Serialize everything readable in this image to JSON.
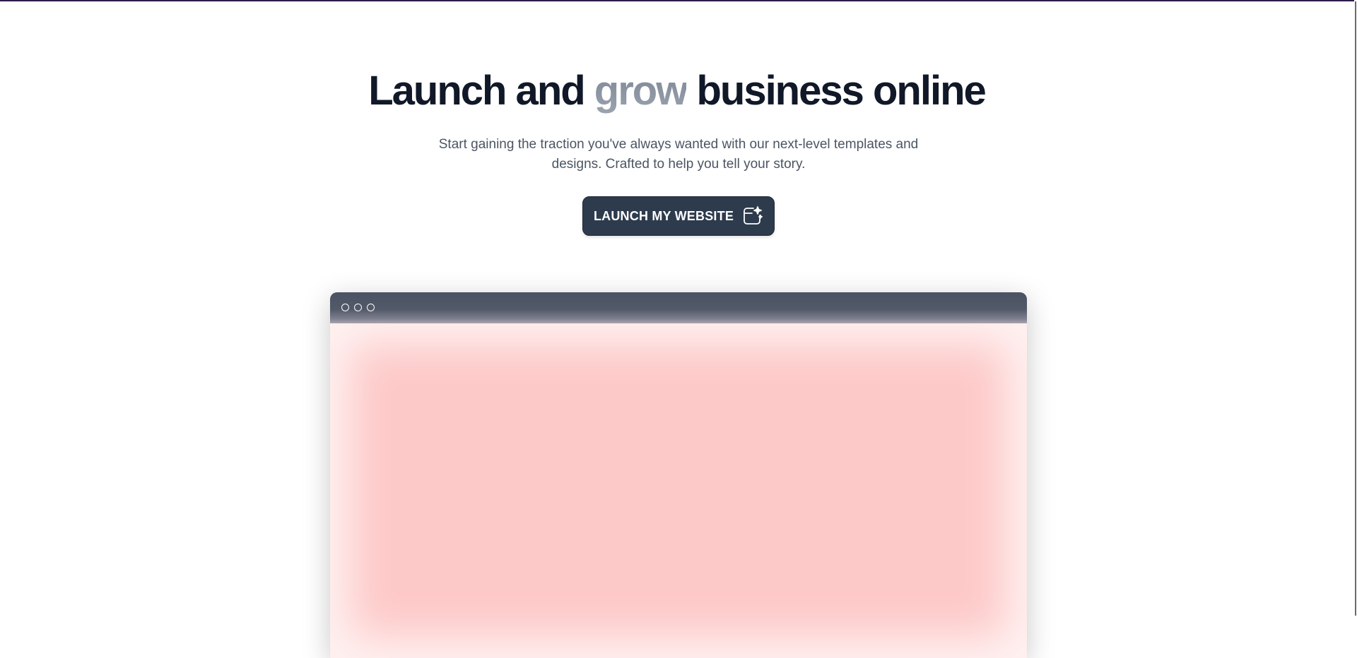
{
  "hero": {
    "headline_part1": "Launch and ",
    "headline_accent": "grow",
    "headline_part2": " business online",
    "subtitle": "Start gaining the traction you've always wanted with our next-level templates and designs. Crafted to help you tell your story.",
    "cta_label": "LAUNCH MY WEBSITE",
    "cta_icon": "sparkle-window-icon"
  },
  "preview": {
    "window_controls": [
      "dot",
      "dot",
      "dot"
    ],
    "body_color": "#fdc9c8",
    "bar_color": "#4a5363"
  },
  "colors": {
    "headline": "#111827",
    "accent_text": "#8a939f",
    "subtitle": "#4b5563",
    "cta_background": "#2d3b4d",
    "top_accent": "#2e1a4a"
  }
}
